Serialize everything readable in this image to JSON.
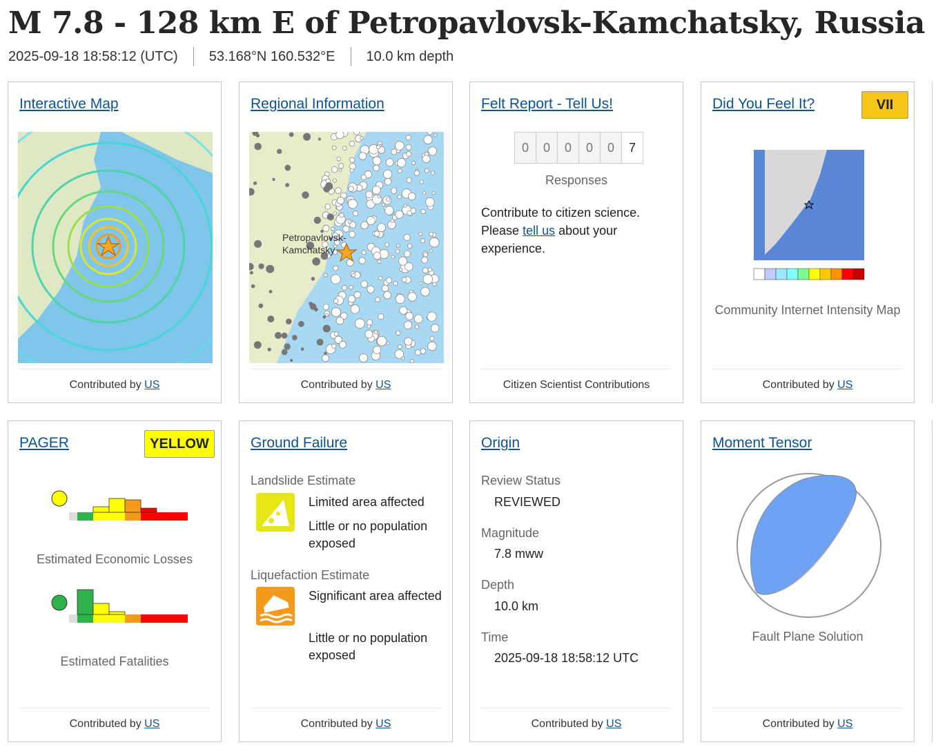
{
  "header": {
    "title": "M 7.8 - 128 km E of Petropavlovsk-Kamchatsky, Russia",
    "time": "2025-09-18 18:58:12 (UTC)",
    "location": "53.168°N 160.532°E",
    "depth": "10.0 km depth"
  },
  "contributed_prefix": "Contributed by",
  "contributor": "US",
  "colors": {
    "link": "#0b5394",
    "dyfi_badge": "#f5c518",
    "pager_badge": "#ffff00"
  },
  "cards": {
    "interactive_map": {
      "title": "Interactive Map"
    },
    "regional_info": {
      "title": "Regional Information",
      "map_label_1": "Petropavlovsk-",
      "map_label_2": "Kamchatsky"
    },
    "felt_report": {
      "title": "Felt Report - Tell Us!",
      "digits": [
        "0",
        "0",
        "0",
        "0",
        "0",
        "7"
      ],
      "responses_label": "Responses",
      "text_before": "Contribute to citizen science. Please",
      "link_text": "tell us",
      "text_after": "about your experience.",
      "footer": "Citizen Scientist Contributions"
    },
    "dyfi": {
      "title": "Did You Feel It?",
      "badge": "VII",
      "caption": "Community Internet Intensity Map"
    },
    "pager": {
      "title": "PAGER",
      "badge": "YELLOW",
      "econ_caption": "Estimated Economic Losses",
      "fatal_caption": "Estimated Fatalities"
    },
    "ground_failure": {
      "title": "Ground Failure",
      "landslide_label": "Landslide Estimate",
      "landslide_area": "Limited area affected",
      "landslide_pop": "Little or no population exposed",
      "liquefaction_label": "Liquefaction Estimate",
      "liq_area": "Significant area affected",
      "liq_pop": "Little or no population exposed"
    },
    "origin": {
      "title": "Origin",
      "review_label": "Review Status",
      "review_value": "REVIEWED",
      "mag_label": "Magnitude",
      "mag_value": "7.8 mww",
      "depth_label": "Depth",
      "depth_value": "10.0 km",
      "time_label": "Time",
      "time_value": "2025-09-18 18:58:12 UTC"
    },
    "moment_tensor": {
      "title": "Moment Tensor",
      "caption": "Fault Plane Solution"
    }
  }
}
